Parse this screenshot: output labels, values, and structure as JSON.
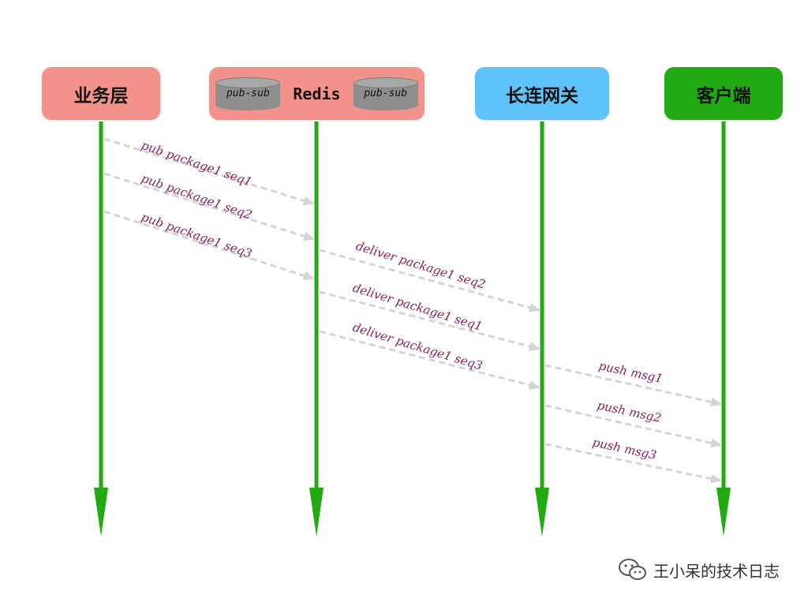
{
  "actors": {
    "business": "业务层",
    "redis": "Redis",
    "redis_left_db": "pub-sub",
    "redis_right_db": "pub-sub",
    "gateway": "长连网关",
    "client": "客户端"
  },
  "colors": {
    "business": "#f2928b",
    "redis": "#f2928b",
    "gateway": "#5ec3fb",
    "client": "#22aa12",
    "lifeline": "#22aa12",
    "message_text": "#8a1f5e",
    "message_arrow": "#d4d4d4"
  },
  "messages": [
    {
      "label": "pub package1 seq1",
      "from": "business",
      "to": "redis"
    },
    {
      "label": "pub package1 seq2",
      "from": "business",
      "to": "redis"
    },
    {
      "label": "pub package1 seq3",
      "from": "business",
      "to": "redis"
    },
    {
      "label": "deliver  package1 seq2",
      "from": "redis",
      "to": "gateway"
    },
    {
      "label": "deliver  package1 seq1",
      "from": "redis",
      "to": "gateway"
    },
    {
      "label": "deliver  package1 seq3",
      "from": "redis",
      "to": "gateway"
    },
    {
      "label": "push msg1",
      "from": "gateway",
      "to": "client"
    },
    {
      "label": "push msg2",
      "from": "gateway",
      "to": "client"
    },
    {
      "label": "push msg3",
      "from": "gateway",
      "to": "client"
    }
  ],
  "watermark": {
    "icon": "wechat-icon",
    "text": "王小呆的技术日志"
  }
}
